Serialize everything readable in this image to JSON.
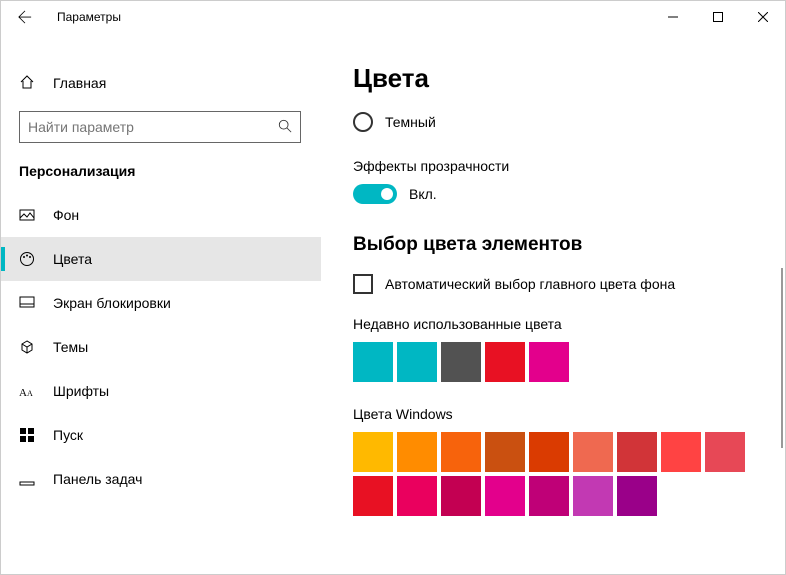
{
  "window": {
    "title": "Параметры"
  },
  "sidebar": {
    "home": "Главная",
    "search_placeholder": "Найти параметр",
    "section": "Персонализация",
    "items": [
      {
        "label": "Фон"
      },
      {
        "label": "Цвета"
      },
      {
        "label": "Экран блокировки"
      },
      {
        "label": "Темы"
      },
      {
        "label": "Шрифты"
      },
      {
        "label": "Пуск"
      },
      {
        "label": "Панель задач"
      }
    ]
  },
  "main": {
    "title": "Цвета",
    "radio_dark": "Темный",
    "transparency_label": "Эффекты прозрачности",
    "transparency_state": "Вкл.",
    "accent_heading": "Выбор цвета элементов",
    "auto_pick": "Автоматический выбор главного цвета фона",
    "recent_label": "Недавно использованные цвета",
    "recent_colors": [
      "#00b7c3",
      "#00b7c3",
      "#525252",
      "#e81123",
      "#e3008c"
    ],
    "windows_label": "Цвета Windows",
    "windows_colors_row1": [
      "#ffb900",
      "#ff8c00",
      "#f7630c",
      "#ca5010",
      "#da3b01",
      "#ef6950",
      "#d13438",
      "#ff4343"
    ],
    "windows_colors_row2": [
      "#e74856",
      "#e81123",
      "#ea005e",
      "#c30052",
      "#e3008c",
      "#bf0077",
      "#c239b3",
      "#9a0089"
    ]
  },
  "accent": "#00b7c3"
}
